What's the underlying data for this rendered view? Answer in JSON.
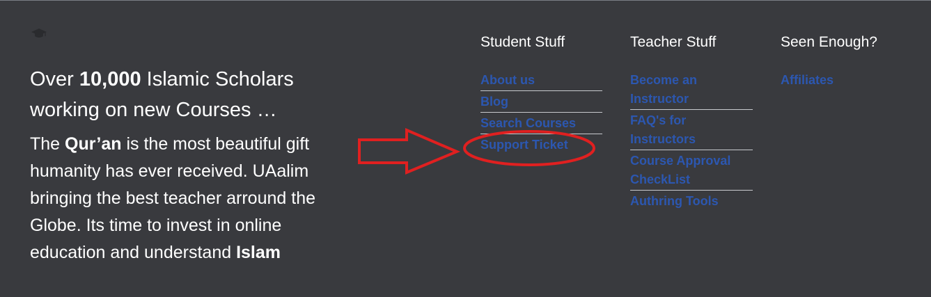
{
  "about": {
    "headline_pre": "Over ",
    "headline_bold": "10,000",
    "headline_post": " Islamic Scholars working on new Courses …",
    "body_pre": "The ",
    "body_bold1": "Qur’an",
    "body_mid": " is the most beautiful gift humanity has ever received. UAalim bringing the best teacher arround the Globe. Its time to invest in online education and understand ",
    "body_bold2": "Islam"
  },
  "columns": {
    "student": {
      "title": "Student Stuff",
      "links": [
        "About us",
        "Blog",
        "Search Courses",
        "Support Ticket"
      ]
    },
    "teacher": {
      "title": "Teacher Stuff",
      "links": [
        "Become an Instructor",
        "FAQ's for Instructors",
        "Course Approval CheckList",
        "Authring Tools"
      ]
    },
    "seen": {
      "title": "Seen Enough?",
      "links": [
        "Affiliates"
      ]
    }
  },
  "icons": {
    "logo": "graduation-cap-icon"
  },
  "colors": {
    "background": "#393a3e",
    "link": "#2c57b0",
    "annotation": "#e02020"
  }
}
